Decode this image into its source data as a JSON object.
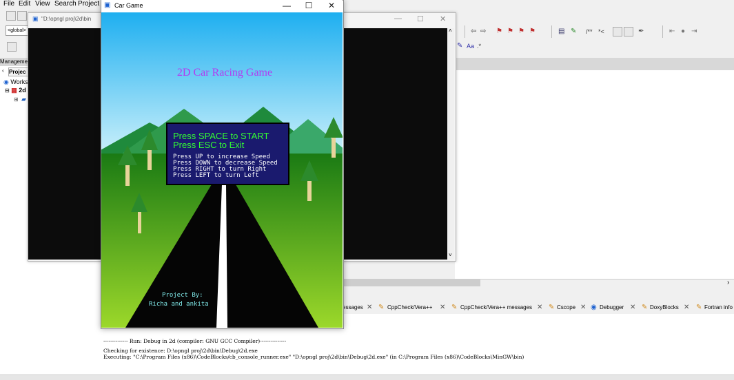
{
  "ide": {
    "menu": [
      "File",
      "Edit",
      "View",
      "Search",
      "Project"
    ],
    "scope_combo": "<global>",
    "management_title": "Managemen",
    "projects_tab": "Projec",
    "workspace_label": "Works",
    "project_label": "2d",
    "log_tabs": [
      {
        "label": "essages"
      },
      {
        "label": "CppCheck/Vera++"
      },
      {
        "label": "CppCheck/Vera++ messages"
      },
      {
        "label": "Cscope"
      },
      {
        "label": "Debugger"
      },
      {
        "label": "DoxyBlocks"
      },
      {
        "label": "Fortran info"
      }
    ],
    "log_lines": [
      "-------------- Run: Debug in 2d (compiler: GNU GCC Compiler)---------------",
      "Checking for existence: D:\\opngl proj\\2d\\bin\\Debug\\2d.exe",
      "Executing: \"C:\\Program Files (x86)\\CodeBlocks/cb_console_runner.exe\" \"D:\\opngl proj\\2d\\bin\\Debug\\2d.exe\"  (in C:\\Program Files (x86)\\CodeBlocks\\MinGW\\bin)"
    ]
  },
  "bg_window": {
    "title": "\"D:\\opngl proj\\2d\\bin"
  },
  "game_window": {
    "title": "Car Game",
    "controls": {
      "minimize": "—",
      "maximize": "☐",
      "close": "✕"
    }
  },
  "game": {
    "heading": "2D Car Racing Game",
    "box_lines_large": [
      "Press SPACE to START",
      "Press ESC to Exit"
    ],
    "box_lines_small": [
      "Press UP to increase Speed",
      "Press DOWN to decrease Speed",
      "Press RIGHT to turn Right",
      "Press LEFT to turn Left"
    ],
    "credit_title": "Project By:",
    "credit_names": "Richa and ankita",
    "colors": {
      "sky_top": "#1eaff0",
      "sky_bottom": "#c5eefa",
      "grass": "#1a7a14",
      "road": "#050505",
      "box_bg": "#1a1a6e",
      "heading_text": "#b23cf0",
      "box_large_text": "#33ff33",
      "box_small_text": "#ffffff",
      "credit_text": "#7fe8e8"
    }
  }
}
